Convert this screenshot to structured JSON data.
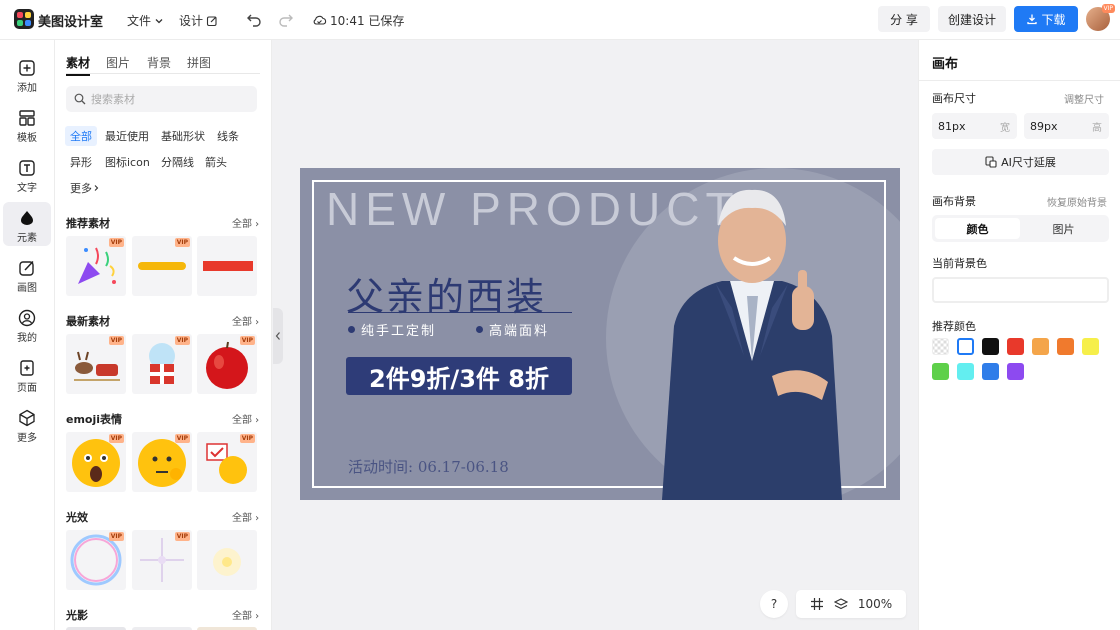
{
  "topbar": {
    "brand": "美图设计室",
    "file_menu": "文件",
    "design_menu": "设计",
    "save_status": "10:41 已保存",
    "share_label": "分 享",
    "create_label": "创建设计",
    "download_label": "下载",
    "avatar_badge": "VIP"
  },
  "rail": [
    {
      "label": "添加",
      "icon": "plus-square-icon"
    },
    {
      "label": "模板",
      "icon": "template-icon"
    },
    {
      "label": "文字",
      "icon": "text-icon"
    },
    {
      "label": "元素",
      "icon": "element-icon"
    },
    {
      "label": "画图",
      "icon": "draw-icon"
    },
    {
      "label": "我的",
      "icon": "user-icon"
    },
    {
      "label": "页面",
      "icon": "page-add-icon"
    },
    {
      "label": "更多",
      "icon": "cube-icon"
    }
  ],
  "panel": {
    "tabs": [
      "素材",
      "图片",
      "背景",
      "拼图"
    ],
    "search_placeholder": "搜索素材",
    "chips": [
      "全部",
      "最近使用",
      "基础形状",
      "线条",
      "异形",
      "图标icon",
      "分隔线",
      "箭头",
      "更多"
    ],
    "all_label": "全部",
    "vip": "VIP",
    "sections": [
      "推荐素材",
      "最新素材",
      "emoji表情",
      "光效",
      "光影"
    ]
  },
  "canvas": {
    "headline": "NEW PRODUCT",
    "title": "父亲的西装",
    "bullet1": "纯手工定制",
    "bullet2": "高端面料",
    "promo": "2件9折/3件 8折",
    "date": "活动时间:  06.17-06.18"
  },
  "bottom": {
    "help": "?",
    "zoom": "100%"
  },
  "right": {
    "title": "画布",
    "size_label": "画布尺寸",
    "adjust_label": "调整尺寸",
    "width_value": "81px",
    "width_unit": "宽",
    "height_value": "89px",
    "height_unit": "高",
    "ai_button": "AI尺寸延展",
    "bg_label": "画布背景",
    "restore_label": "恢复原始背景",
    "seg_color": "颜色",
    "seg_image": "图片",
    "current_bg_label": "当前背景色",
    "recommend_label": "推荐颜色",
    "swatches": [
      "transparent",
      "#ffffff",
      "#111111",
      "#e8392b",
      "#f4a54a",
      "#f07a2d",
      "#f6ef4a",
      "#5ed04a",
      "#63eef0",
      "#2f7de9",
      "#8d4af0"
    ]
  }
}
